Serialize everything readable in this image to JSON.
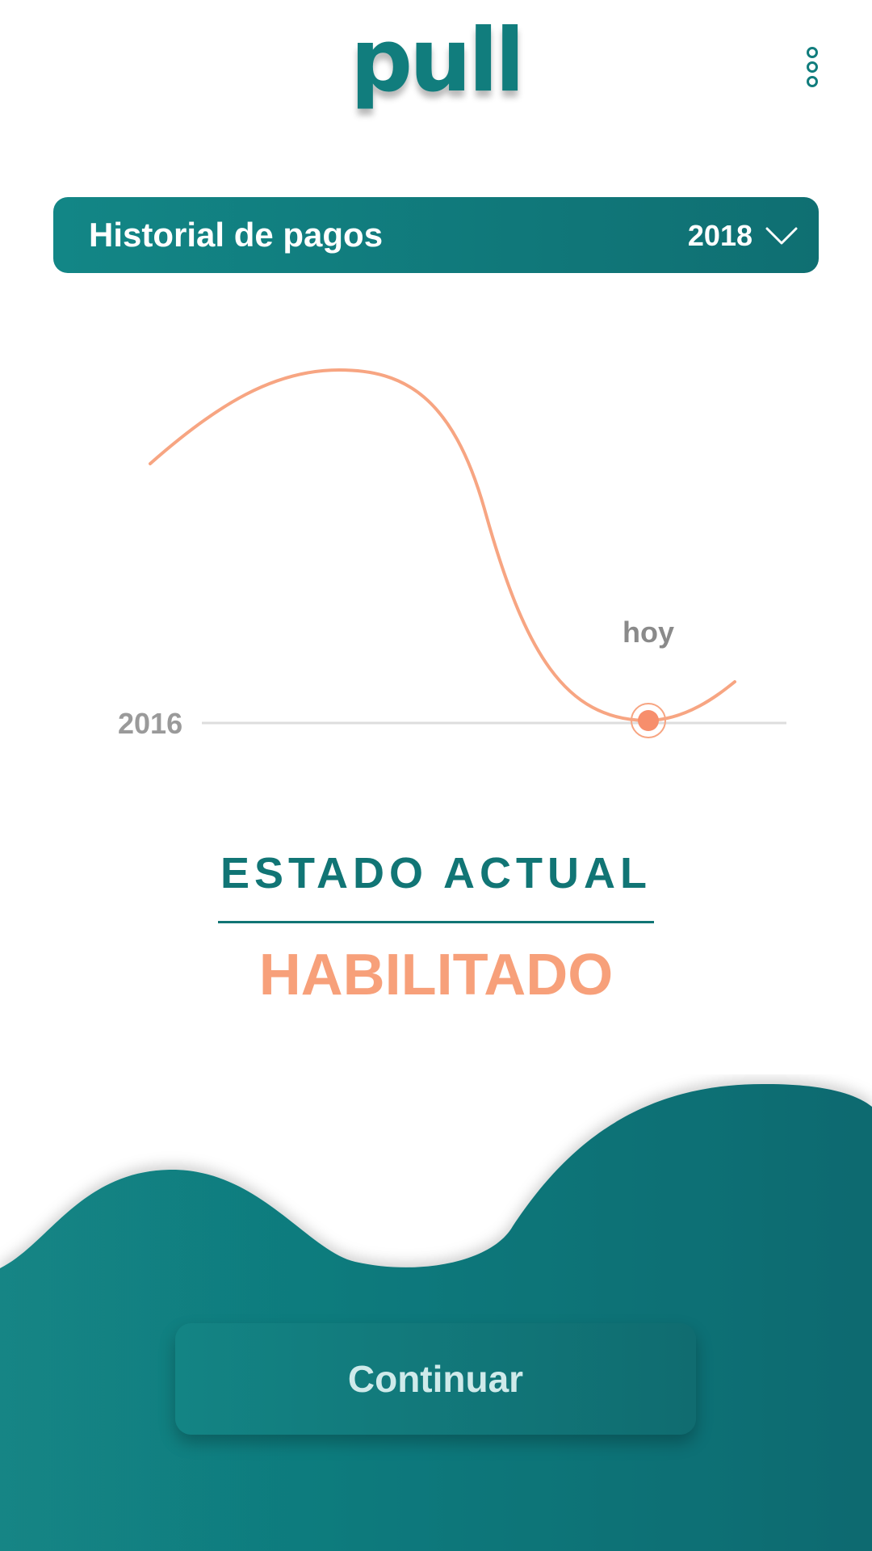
{
  "header": {
    "logo_text": "pull",
    "menu_icon": "more-vertical-icon"
  },
  "history": {
    "title": "Historial de pagos",
    "year": "2018",
    "dropdown_icon": "chevron-down-icon"
  },
  "chart": {
    "start_label": "2016",
    "today_label": "hoy",
    "colors": {
      "line": "#f7a582",
      "baseline": "#dddddd",
      "label": "#8a8a8a"
    }
  },
  "status": {
    "title": "ESTADO ACTUAL",
    "value": "HABILITADO"
  },
  "actions": {
    "continue_label": "Continuar"
  },
  "theme": {
    "primary": "#117d7d",
    "accent": "#f7a07a"
  }
}
